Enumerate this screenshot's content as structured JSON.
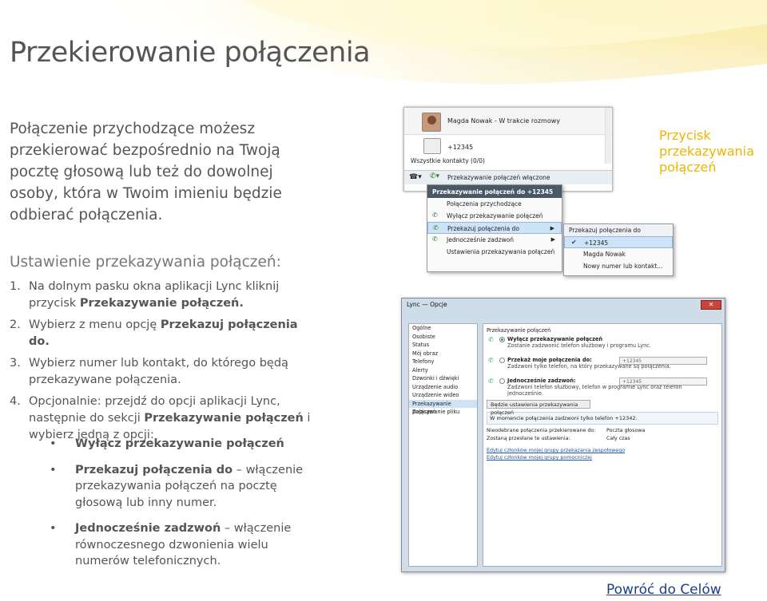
{
  "title": "Przekierowanie połączenia",
  "intro": "Połączenie przychodzące możesz przekierować bezpośrednio na Twoją pocztę głosową lub też do dowolnej osoby, która w Twoim imieniu będzie odbierać połączenia.",
  "subhead": "Ustawienie przekazywania połączeń:",
  "steps": [
    {
      "num": "1.",
      "a": "Na dolnym pasku okna aplikacji Lync kliknij przycisk ",
      "b": "Przekazywanie połączeń.",
      "c": ""
    },
    {
      "num": "2.",
      "a": "Wybierz z menu opcję ",
      "b": "Przekazuj połączenia do.",
      "c": ""
    },
    {
      "num": "3.",
      "a": "Wybierz numer lub kontakt, do którego będą przekazywane połączenia.",
      "b": "",
      "c": ""
    },
    {
      "num": "4.",
      "a": "Opcjonalnie: przejdź do opcji aplikacji Lync, następnie do sekcji ",
      "b": "Przekazywanie połączeń",
      "c": " i wybierz jedną z opcji:"
    }
  ],
  "bullets": [
    {
      "dot": "•",
      "b": "Wyłącz przekazywanie połączeń",
      "rest": ""
    },
    {
      "dot": "•",
      "b": "Przekazuj połączenia do",
      "rest": " – włączenie przekazywania połączeń na pocztę głosową lub inny numer."
    },
    {
      "dot": "•",
      "b": "Jednocześnie zadzwoń",
      "rest": " – włączenie równoczesnego dzwonienia wielu numerów telefonicznych."
    }
  ],
  "callout": "Przycisk przekazywania połączeń",
  "goal_link": "Powróć do Celów",
  "shot1": {
    "contact_name": "Magda Nowak - W trakcie rozmowy",
    "number": "+12345",
    "all_contacts": "Wszystkie  kontakty (0/0)",
    "forward_status": "Przekazywanie połączeń włączone",
    "menu_header": "Przekazywanie połączeń do +12345",
    "menu_items": [
      "Połączenia przychodzące",
      "Wyłącz przekazywanie połączeń",
      "Przekazuj połączenia do",
      "Jednocześnie zadzwoń",
      "Ustawienia przekazywania połączeń"
    ],
    "sub_items": [
      "Przekazuj połączenia do",
      "+12345",
      "Magda Nowak",
      "Nowy numer lub kontakt..."
    ]
  },
  "shot2": {
    "window_title": "Lync — Opcje",
    "close": "✕",
    "nav": [
      "Ogólne",
      "Osobiste",
      "Status",
      "Mój obraz",
      "Telefony",
      "Alerty",
      "Dzwonki i dźwięki",
      "Urządzenie audio",
      "Urządzenie wideo",
      "Przekazywanie połączeń",
      "Zapisywanie pliku"
    ],
    "section": "Przekazywanie połączeń",
    "opt1_b": "Wyłącz przekazywanie połączeń",
    "opt1_s": "Zostanie zadzwonić telefon służbowy i programu Lync.",
    "opt2_b": "Przekaż moje połączenia do:",
    "opt2_dd": "+12345",
    "opt2_s": "Zadzwoni tylko telefon, na który przekazywane są połączenia.",
    "opt3_b": "Jednocześnie zadzwoń:",
    "opt3_dd": "+12345",
    "opt3_s": "Zadzwoni telefon służbowy, telefon w programie Lync oraz telefon jednocześnie.",
    "btnset": "Będzie ustawienia przekazywania połączeń",
    "info": "W momencie połączenia zadzwoni tylko telefon +12342.",
    "kv": [
      [
        "Nieodebrane połączenia przekierowane do:",
        "Poczta głosowa"
      ],
      [
        "Zostaną przesłane te ustawienia:",
        "Cały czas"
      ]
    ],
    "links": [
      "Edytuj członków mojej grupy przekazania zespołowego",
      "Edytuj członków mojej grupy pomocniczej"
    ]
  }
}
